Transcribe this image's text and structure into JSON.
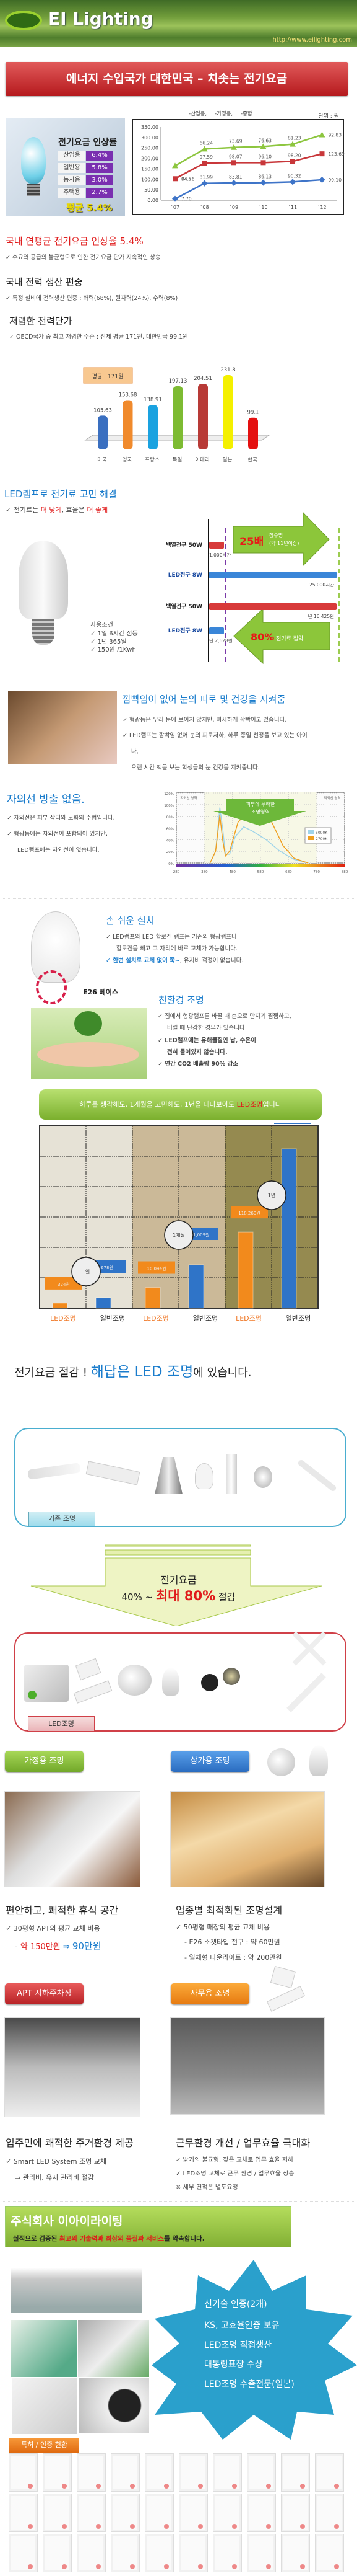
{
  "header": {
    "brand": "EI Lighting",
    "url": "http://www.eilighting.com"
  },
  "title_banner": "에너지 수입국가 대한민국 – 치솟는 전기요금",
  "rate_image": {
    "title": "전기요금 인상률",
    "rows": [
      {
        "k": "산업용",
        "v": "6.4%"
      },
      {
        "k": "일반용",
        "v": "5.8%"
      },
      {
        "k": "농사용",
        "v": "3.0%"
      },
      {
        "k": "주택용",
        "v": "2.7%"
      }
    ],
    "average": "평균 5.4%"
  },
  "section_rate": {
    "heading": "국내 연평균 전기요금 인상율 5.4%",
    "bullet": "✓ 수요와 공급의 불균형으로 인한 전기요금 단가 지속적인 상승"
  },
  "section_bias": {
    "heading": "국내 전력 생산 편중",
    "bullet": "✓ 특정 설비에 전력생산 편중 : 화력(68%), 원자력(24%), 수력(8%)"
  },
  "section_cheap": {
    "heading": "저렴한 전력단가",
    "bullet": "✓ OECD국가 중 최고 저렴한 수준 : 전체 평균 171원, 대한민국 99.1원"
  },
  "chart_data": [
    {
      "type": "line",
      "legend": [
        "산업용",
        "가정용",
        "종합"
      ],
      "legend_colors": [
        "#8dc63f",
        "#c8373a",
        "#3e74c8"
      ],
      "unit": "단위 : 원",
      "categories": [
        "`07",
        "`08",
        "`09",
        "`10",
        "`11",
        "`12"
      ],
      "ylim": [
        0,
        350
      ],
      "yticks": [
        "0.00",
        "50.00",
        "100.00",
        "150.00",
        "200.00",
        "250.00",
        "300.00",
        "350.00"
      ],
      "series": [
        {
          "name": "산업용",
          "color": "#8dc63f",
          "values": [
            165,
            245,
            253,
            257,
            268,
            313
          ],
          "labels": [
            "64.56",
            "66.24",
            "73.69",
            "76.63",
            "81.23",
            "92.83"
          ]
        },
        {
          "name": "가정용",
          "color": "#c8373a",
          "values": [
            103,
            178,
            180,
            180,
            186,
            222
          ],
          "labels": [
            "94.78",
            "97.59",
            "98.07",
            "96.10",
            "98.20",
            "123.69"
          ]
        },
        {
          "name": "종합",
          "color": "#3e74c8",
          "values": [
            7,
            81,
            83,
            84,
            88,
            98
          ],
          "labels": [
            "7.70",
            "81.99",
            "83.81",
            "86.13",
            "90.32",
            "99.10"
          ]
        }
      ]
    },
    {
      "type": "bar",
      "categories": [
        "미국",
        "영국",
        "프랑스",
        "독일",
        "이태리",
        "일본",
        "한국"
      ],
      "values": [
        105.63,
        153.68,
        138.91,
        197.13,
        204.51,
        231.8,
        99.1
      ],
      "labels": [
        "105.63",
        "153.68",
        "138.91",
        "197.13",
        "204.51",
        "231.8",
        "99.1"
      ],
      "colors": [
        "#3a6fc0",
        "#f08a2c",
        "#1aa2e0",
        "#7dbb32",
        "#b83a36",
        "#f4f000",
        "#e41010"
      ],
      "annotation": "평균 : 171원"
    },
    {
      "type": "line",
      "title": "피부에 무해한 조명영역",
      "xticks": [
        "280",
        "380",
        "480",
        "580",
        "680",
        "780",
        "880"
      ],
      "yticks": [
        "0%",
        "20%",
        "40%",
        "60%",
        "80%",
        "100%",
        "120%"
      ],
      "xlim": [
        280,
        880
      ],
      "ylim": [
        0,
        120
      ],
      "regions": [
        "자외선 영역",
        "적외선 영역"
      ],
      "legend_placement": "right",
      "series": [
        {
          "name": "5000K",
          "color": "#9fd4ea",
          "x": [
            400,
            420,
            435,
            445,
            455,
            470,
            490,
            520,
            550,
            600,
            650,
            700,
            750
          ],
          "values": [
            0,
            20,
            95,
            60,
            15,
            15,
            45,
            62,
            55,
            40,
            20,
            6,
            0
          ]
        },
        {
          "name": "2700K",
          "color": "#f0a020",
          "x": [
            400,
            420,
            435,
            445,
            455,
            470,
            500,
            540,
            580,
            620,
            660,
            700,
            750
          ],
          "values": [
            0,
            20,
            82,
            40,
            12,
            20,
            70,
            90,
            100,
            70,
            30,
            8,
            0
          ]
        }
      ]
    },
    {
      "type": "bar",
      "title": "하루를 생각해도, 1개월을 고민해도, 1년을 내다보아도 LED조명입니다",
      "groups": [
        "1일",
        "1개월",
        "1년"
      ],
      "series": [
        {
          "name": "LED조명",
          "color": "#f28a1c",
          "values": [
            324,
            10044,
            118260
          ],
          "labels": [
            "324원",
            "10,044원",
            "118,260원"
          ]
        },
        {
          "name": "일반조명",
          "color": "#2f74c8",
          "values": [
            678,
            21009,
            247351
          ],
          "labels": [
            "678원",
            "21,009원",
            "247,351원"
          ]
        }
      ],
      "xlabels": [
        "LED조명",
        "일반조명",
        "LED조명",
        "일반조명",
        "LED조명",
        "일반조명"
      ]
    }
  ],
  "section_led": {
    "heading": "LED램프로 전기료 고민 해결",
    "bullet_pre": "✓ 전기료는 ",
    "bullet_r1": "더 낮게",
    "bullet_mid": ", 효율은 ",
    "bullet_r2": "더 좋게"
  },
  "lifespan": {
    "conditions_title": "사용조건",
    "conditions": [
      "✓ 1일 6시간 점등",
      "✓ 1년 365일",
      "✓ 150원 /1Kwh"
    ],
    "rows": [
      {
        "label": "백열전구 50W",
        "value": "1,000시간"
      },
      {
        "label": "LED전구 8W",
        "value": "25,000시간"
      },
      {
        "label": "백열전구 50W",
        "value": "년 16,425원"
      },
      {
        "label": "LED전구 8W",
        "value": "년 2,628원"
      }
    ],
    "arrow1_big": "25배",
    "arrow1_small1": "장수명",
    "arrow1_small2": "(약 11년이상)",
    "arrow2_big": "80%",
    "arrow2_small": "전기료 절약"
  },
  "section_flicker": {
    "heading": "깜빡임이 없어 눈의 피로 및 건강을 지켜줌",
    "bullets": [
      "✓ 형광등은 우리 눈에 보이지 않지만, 미세하게 깜빡이고 있습니다.",
      "✓ LED램프는 깜빡임 없어 눈의 피로저하, 하루 종일 천정을 보고 있는 아이",
      "나,",
      "오랜 시간 책을 보는 학생들의 눈 건강을 지켜줍니다."
    ]
  },
  "section_uv": {
    "heading": "자외선 방출 없음.",
    "bullets": [
      "✓ 자외선은 피부 잡티와 노화의 주범입니다.",
      "✓ 형광등에는 자외선이 포함되어 있지만,",
      "LED램프에는 자외선이 없습니다."
    ]
  },
  "section_install": {
    "heading": "손 쉬운 설치",
    "base_label": "E26 베이스",
    "bullets": [
      "✓ LED램프와 LED 할로겐 램프는 기존의 형광램프나",
      "할로겐을 빼고 그 자리에 바로 교체가 가능합니다."
    ],
    "bullet3_blue": "✓ 한번 설치로 교체 없이 쭉~",
    "bullet3_rest": ", 유지비 걱정이 없습니다."
  },
  "section_eco": {
    "heading": "친환경 조명",
    "bullets": [
      "✓ 집에서 형광램프를 바꿀 때 손으로 만지기 찜찜하고,",
      "버릴 때 난감한 경우가 있습니다",
      "✓ LED램프에는 유해물질인 납, 수은이",
      "전혀 들어있지 않습니다.",
      "✓ 연간 CO2 배출량 90% 감소"
    ]
  },
  "green_banner": {
    "text": "하루를 생각해도, 1개월을 고민해도, 1년을 내다보아도 ",
    "red": "LED조명",
    "tail": "입니다"
  },
  "answer": {
    "pre": "전기요금 절감 !  ",
    "blue": "해답은 LED 조명",
    "post": "에 있습니다."
  },
  "existing_tag": "기존 조명",
  "saving_arrow": {
    "line1": "전기요금",
    "pre": "40% ~ ",
    "red": "최대 80%",
    "post": " 절감"
  },
  "led_tag": "LED조명",
  "buttons": {
    "home": "가정용 조명",
    "shop": "상가용 조명",
    "parking": "APT 지하주차장",
    "office": "사무용 조명"
  },
  "home": {
    "heading": "편안하고, 쾌적한 휴식 공간",
    "bullet": "✓ 30평형 APT의 평균 교체 비용",
    "old_price": "약 150만원",
    "arrow": "⇒ ",
    "new_price": "90만원"
  },
  "shop": {
    "heading": "업종별 최적화된 조명설계",
    "bullets": [
      "✓ 50평형 매장의 평균 교체 비용",
      "- E26 소켓타입 전구 : 약 60만원",
      "- 일체형 다운라이트 : 약 200만원"
    ]
  },
  "parking": {
    "heading": "입주민에 쾌적한 주거환경 제공",
    "bullets": [
      "✓ Smart LED System 조명 교체",
      "⇒ 관리비, 유지 관리비 절감"
    ]
  },
  "office": {
    "heading": "근무환경 개선 / 업무효율 극대화",
    "bullets": [
      "✓ 밝기의 불균형, 잦은 교체로 업무 효율 저하",
      "✓ LED조명 교체로 근무 환경 / 업무효율 상승",
      "※ 세부 견적은 별도요청"
    ]
  },
  "company": {
    "name": "주식회사 이아이라이팅",
    "sub_pre": "실적으로 검증된 ",
    "sub_red": "최고의 기술력과 최상의 품질과 서비스",
    "sub_post": "를 약속합니다.",
    "star": [
      "신기술 인증(2개)",
      "KS, 고효율인증 보유",
      "LED조명 직접생산",
      "대통령표창 수상",
      "LED조명 수출전문(일본)"
    ],
    "cert_tag": "특허 / 인증 현황"
  }
}
